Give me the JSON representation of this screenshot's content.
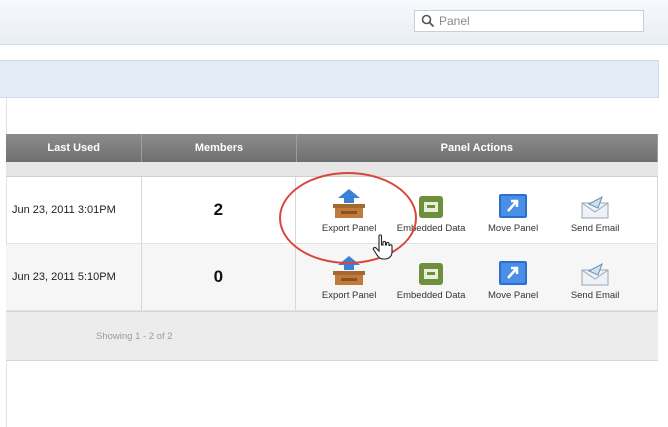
{
  "search": {
    "placeholder": "Panel"
  },
  "table": {
    "headers": [
      "Last Used",
      "Members",
      "Panel Actions"
    ],
    "rows": [
      {
        "last_used": "Jun 23, 2011 3:01PM",
        "members": "2"
      },
      {
        "last_used": "Jun 23, 2011 5:10PM",
        "members": "0"
      }
    ],
    "actions": [
      "Export Panel",
      "Embedded Data",
      "Move Panel",
      "Send Email"
    ],
    "footer": "Showing 1 - 2 of 2"
  },
  "icons": {
    "search": "search-icon",
    "export": "export-panel-icon",
    "embedded": "embedded-data-icon",
    "move": "move-panel-icon",
    "email": "send-email-icon",
    "cursor": "hand-cursor-icon"
  },
  "colors": {
    "header": "#7a7a7a",
    "highlight": "#d9473c",
    "band": "#e4ecf7"
  }
}
